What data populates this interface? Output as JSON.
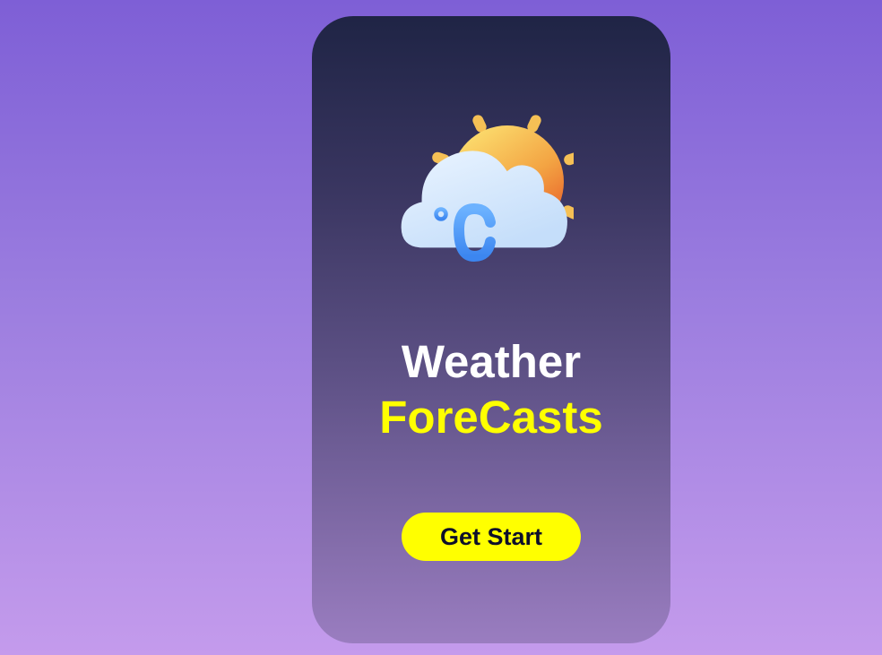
{
  "hero": {
    "illustration_icon": "sun-cloud-celsius-icon",
    "title_line1": "Weather",
    "title_line2": "ForeCasts",
    "title_line2_color": "#ffff00"
  },
  "cta": {
    "label": "Get Start",
    "background": "#ffff00"
  }
}
